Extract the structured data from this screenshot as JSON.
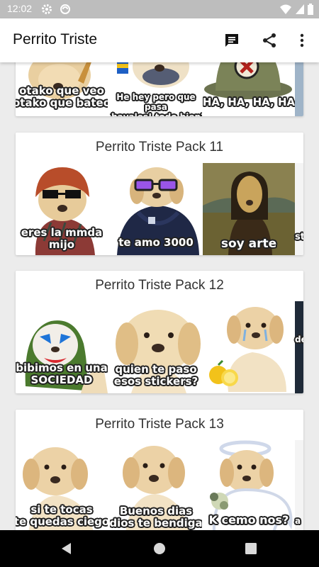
{
  "status_bar": {
    "time": "12:02"
  },
  "app_bar": {
    "title": "Perrito Triste"
  },
  "packs": [
    {
      "title": "",
      "captions": [
        "otako que veo\notako que bateo",
        "He hey pero que pasa\nchavales! todo bien?",
        "HA, HA, HA, HA"
      ]
    },
    {
      "title": "Perrito Triste Pack 11",
      "captions": [
        "eres la mmda\nmijo",
        "te amo 3000",
        "soy arte"
      ],
      "peek": "st"
    },
    {
      "title": "Perrito Triste Pack 12",
      "captions": [
        "bibimos en una\nSOCIEDAD",
        "quien te paso\nesos stickers?",
        ""
      ],
      "peek": "de"
    },
    {
      "title": "Perrito Triste Pack 13",
      "captions": [
        "si te tocas\nte quedas ciego",
        "Buenos dias\ndios te bendiga",
        "K cemo nos?"
      ],
      "peek": "a"
    }
  ],
  "colors": {
    "accent": "#111111",
    "status_bar": "#bdbdbd",
    "background": "#ececec",
    "nav_bar": "#000000"
  }
}
